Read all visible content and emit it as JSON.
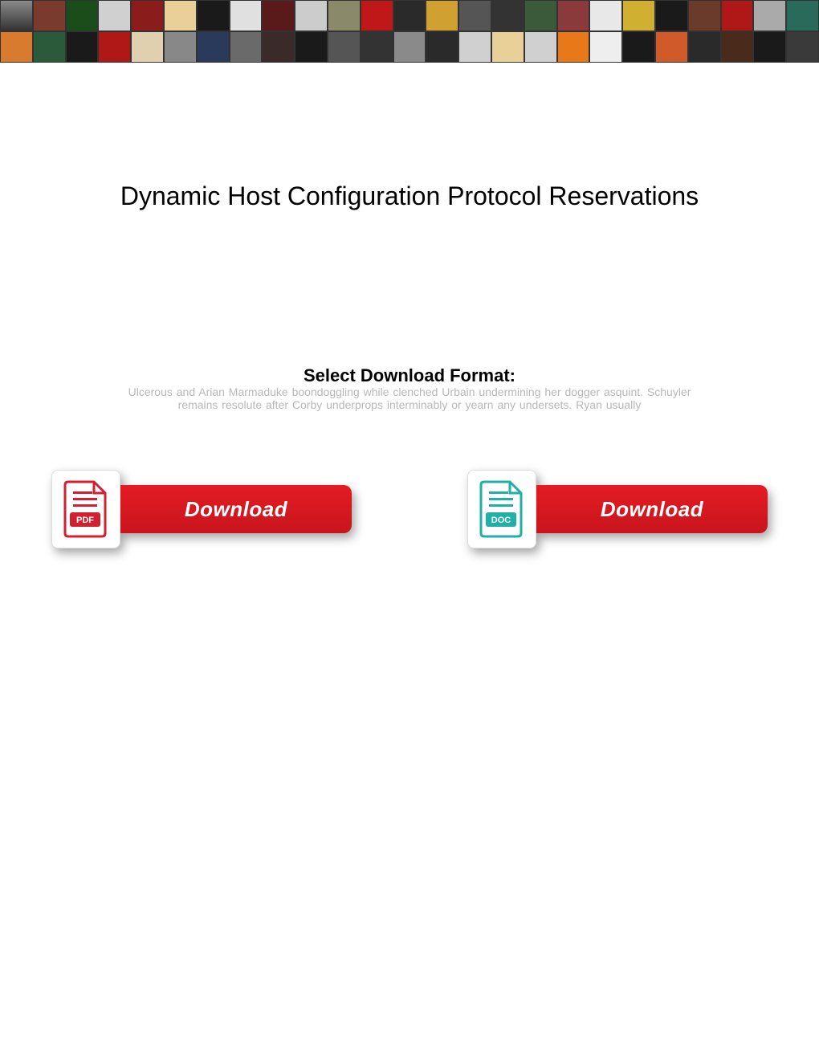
{
  "title": "Dynamic Host Configuration Protocol Reservations",
  "subtitle": "Select Download Format:",
  "faded_text_1": "Ulcerous and Arian Marmaduke boondoggling while clenched Urbain undermining her dogger asquint. Schuyler",
  "faded_text_2": "remains resolute after Corby underprops interminably or yearn any undersets. Ryan usually",
  "downloads": {
    "pdf": {
      "badge": "PDF",
      "label": "Download"
    },
    "doc": {
      "badge": "DOC",
      "label": "Download"
    }
  }
}
